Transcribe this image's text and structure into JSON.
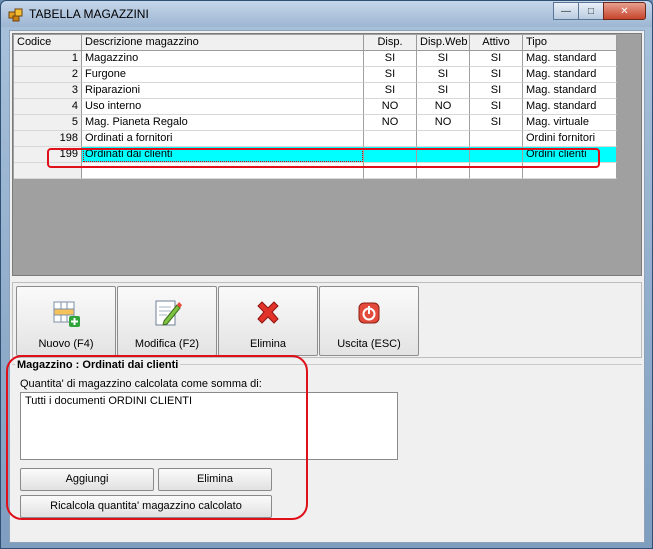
{
  "window": {
    "title": "TABELLA MAGAZZINI"
  },
  "colors": {
    "selected_row": "#00ffff",
    "annotation": "#e0101a",
    "grid_bg": "#a0a0a0"
  },
  "grid": {
    "columns": [
      "Codice",
      "Descrizione magazzino",
      "Disp.",
      "Disp.Web",
      "Attivo",
      "Tipo"
    ],
    "rows": [
      {
        "code": "1",
        "desc": "Magazzino",
        "disp": "SI",
        "web": "SI",
        "attivo": "SI",
        "tipo": "Mag. standard"
      },
      {
        "code": "2",
        "desc": "Furgone",
        "disp": "SI",
        "web": "SI",
        "attivo": "SI",
        "tipo": "Mag. standard"
      },
      {
        "code": "3",
        "desc": "Riparazioni",
        "disp": "SI",
        "web": "SI",
        "attivo": "SI",
        "tipo": "Mag. standard"
      },
      {
        "code": "4",
        "desc": "Uso interno",
        "disp": "NO",
        "web": "NO",
        "attivo": "SI",
        "tipo": "Mag. standard"
      },
      {
        "code": "5",
        "desc": "Mag. Pianeta Regalo",
        "disp": "NO",
        "web": "NO",
        "attivo": "SI",
        "tipo": "Mag. virtuale"
      },
      {
        "code": "198",
        "desc": "Ordinati a fornitori",
        "disp": "",
        "web": "",
        "attivo": "",
        "tipo": "Ordini fornitori"
      },
      {
        "code": "199",
        "desc": "Ordinati dai clienti",
        "disp": "",
        "web": "",
        "attivo": "",
        "tipo": "Ordini clienti"
      }
    ]
  },
  "toolbar": {
    "nuovo": {
      "label": "Nuovo (F4)",
      "icon": "grid-add-icon"
    },
    "modifica": {
      "label": "Modifica (F2)",
      "icon": "edit-pencil-icon"
    },
    "elimina": {
      "label": "Elimina",
      "icon": "red-x-delete-icon"
    },
    "uscita": {
      "label": "Uscita (ESC)",
      "icon": "power-exit-icon"
    }
  },
  "detail": {
    "title": "Magazzino : Ordinati dai clienti",
    "subtitle": "Quantita' di magazzino calcolata come somma di:",
    "items_text": "Tutti i documenti ORDINI CLIENTI",
    "add_label": "Aggiungi",
    "delete_label": "Elimina",
    "recalc_label": "Ricalcola quantita' magazzino calcolato"
  }
}
